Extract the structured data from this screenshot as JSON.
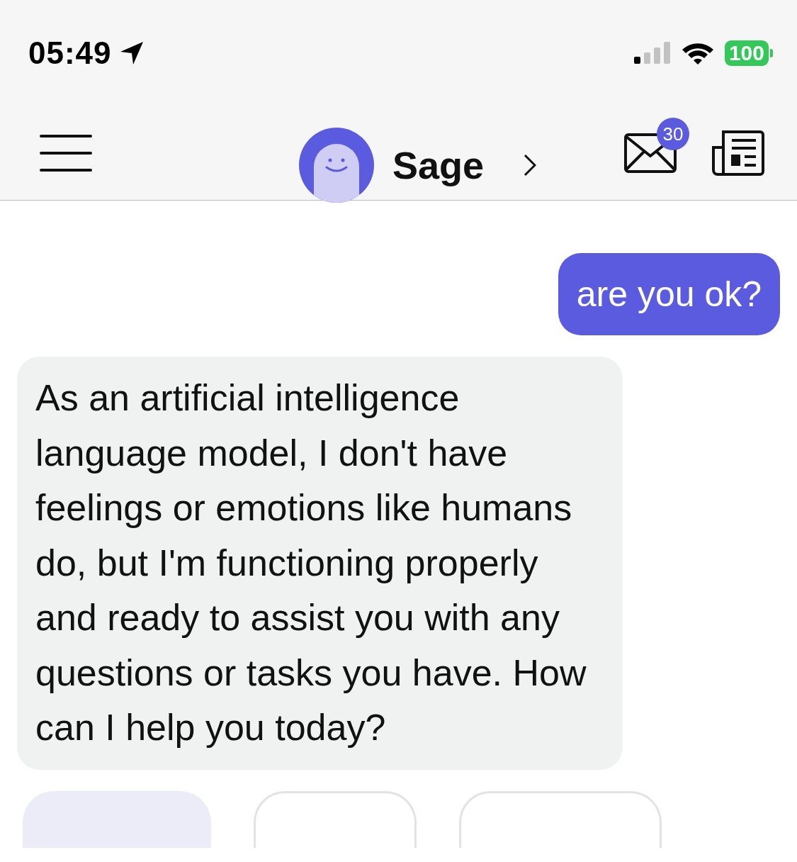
{
  "status_bar": {
    "time": "05:49",
    "battery": "100"
  },
  "header": {
    "title": "Sage",
    "mail_badge": "30"
  },
  "messages": [
    {
      "kind": "sent",
      "text": "are you ok?"
    },
    {
      "kind": "received",
      "text": "As an artificial intelligence language model, I don't have feelings or emotions like humans do, but I'm functioning properly and ready to assist you with any questions or tasks you have. How can I help you today?"
    }
  ]
}
